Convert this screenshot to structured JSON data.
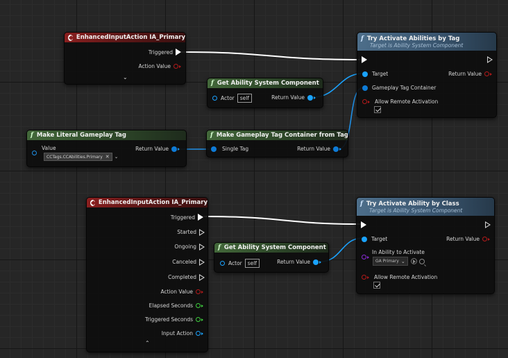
{
  "graph": {
    "node1": {
      "title": "EnhancedInputAction IA_Primary",
      "pins": [
        "Triggered",
        "Action Value"
      ]
    },
    "node2": {
      "title": "Try Activate Abilities by Tag",
      "subtitle": "Target is Ability System Component",
      "target": "Target",
      "return": "Return Value",
      "container": "Gameplay Tag Container",
      "remote": "Allow Remote Activation"
    },
    "node3": {
      "title": "Get Ability System Component",
      "actor": "Actor",
      "self": "self",
      "return": "Return Value"
    },
    "node4": {
      "title": "Make Literal Gameplay Tag",
      "value": "Value",
      "return": "Return Value",
      "tag": "CCTags.CCAbilities.Primary"
    },
    "node5": {
      "title": "Make Gameplay Tag Container from Tag",
      "single": "Single Tag",
      "return": "Return Value"
    },
    "node6": {
      "title": "EnhancedInputAction IA_Primary",
      "pins": [
        "Triggered",
        "Started",
        "Ongoing",
        "Canceled",
        "Completed",
        "Action Value",
        "Elapsed Seconds",
        "Triggered Seconds",
        "Input Action"
      ]
    },
    "node7": {
      "title": "Get Ability System Component",
      "actor": "Actor",
      "self": "self",
      "return": "Return Value"
    },
    "node8": {
      "title": "Try Activate Ability by Class",
      "subtitle": "Target is Ability System Component",
      "target": "Target",
      "return": "Return Value",
      "class_label": "In Ability to Activate",
      "class_value": "GA Primary",
      "remote": "Allow Remote Activation"
    }
  },
  "colors": {
    "exec": "#ffffff",
    "object": "#1aa3ff",
    "struct": "#0e7bd6",
    "bool": "#b31a1a",
    "float": "#3ecf3e",
    "class": "#8a2ad6",
    "event_header": "#8a1f1f",
    "pure_header": "#43683a",
    "function_header": "#4d6e8a"
  },
  "icons": {
    "event": "event-diamond-icon",
    "function": "function-f-icon"
  }
}
